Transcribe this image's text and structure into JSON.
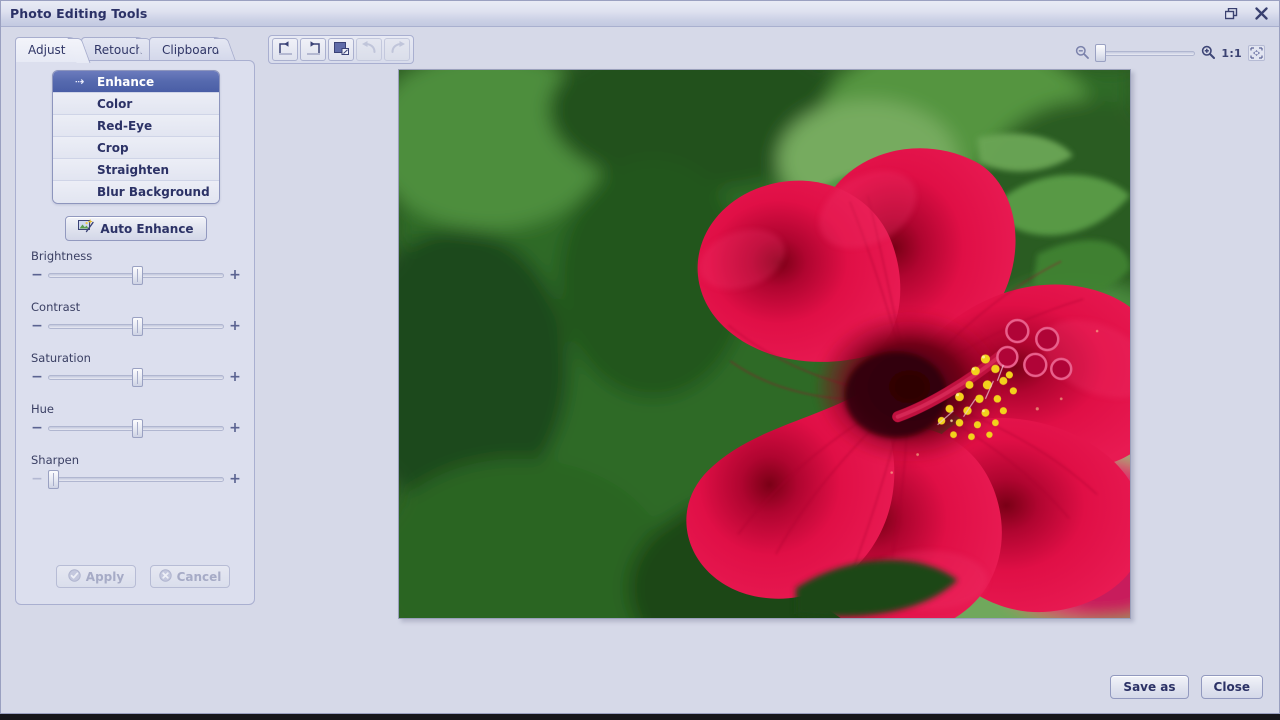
{
  "window": {
    "title": "Photo Editing Tools",
    "restore_icon": "restore-icon",
    "close_icon": "close-icon"
  },
  "tabs": [
    {
      "label": "Adjust",
      "active": true
    },
    {
      "label": "Retouch",
      "active": false
    },
    {
      "label": "Clipboard",
      "active": false
    }
  ],
  "tool_list": [
    {
      "label": "Enhance",
      "selected": true,
      "marker": "⇢"
    },
    {
      "label": "Color",
      "selected": false
    },
    {
      "label": "Red-Eye",
      "selected": false
    },
    {
      "label": "Crop",
      "selected": false
    },
    {
      "label": "Straighten",
      "selected": false
    },
    {
      "label": "Blur Background",
      "selected": false
    }
  ],
  "auto_enhance": {
    "label": "Auto Enhance",
    "icon": "photo-wand-icon"
  },
  "sliders": [
    {
      "label": "Brightness",
      "value": 50,
      "minus": "−",
      "plus": "+",
      "minus_enabled": true
    },
    {
      "label": "Contrast",
      "value": 50,
      "minus": "−",
      "plus": "+",
      "minus_enabled": true
    },
    {
      "label": "Saturation",
      "value": 50,
      "minus": "−",
      "plus": "+",
      "minus_enabled": true
    },
    {
      "label": "Hue",
      "value": 50,
      "minus": "−",
      "plus": "+",
      "minus_enabled": true
    },
    {
      "label": "Sharpen",
      "value": 0,
      "minus": "−",
      "plus": "+",
      "minus_enabled": false
    }
  ],
  "panel_actions": {
    "apply_label": "Apply",
    "apply_icon": "check-circle-icon",
    "apply_enabled": false,
    "cancel_label": "Cancel",
    "cancel_icon": "x-circle-icon",
    "cancel_enabled": false
  },
  "toolbar": [
    {
      "name": "rotate-left-icon",
      "enabled": true
    },
    {
      "name": "rotate-right-icon",
      "enabled": true
    },
    {
      "name": "resize-image-icon",
      "enabled": true
    },
    {
      "name": "undo-icon",
      "enabled": false
    },
    {
      "name": "redo-icon",
      "enabled": false
    }
  ],
  "zoom_bar": {
    "zoom_out_icon": "zoom-out-icon",
    "zoom_in_icon": "zoom-in-icon",
    "slider_value": 0,
    "actual_size_label": "1:1",
    "fit_icon": "fit-to-window-icon"
  },
  "photo": {
    "subject": "red hibiscus flower with green foliage background"
  },
  "footer": {
    "save_as_label": "Save as",
    "close_label": "Close"
  },
  "colors": {
    "title_text": "#2b3166",
    "panel_bg": "#dcdfee",
    "selection": "#5569ae",
    "window_bg": "#d6d9e8",
    "flower": "#d80b3e",
    "foliage": "#2d6b24"
  }
}
